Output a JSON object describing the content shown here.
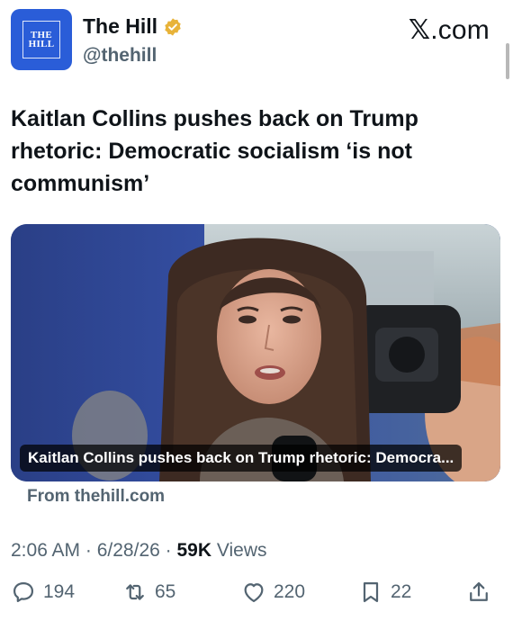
{
  "account": {
    "display_name": "The Hill",
    "handle": "@thehill",
    "avatar_text_line1": "THE",
    "avatar_text_line2": "HILL",
    "verified_badge_color": "#e8b339",
    "avatar_color": "#2a5dd8"
  },
  "brand": {
    "x_letter": "𝕏",
    "suffix": ".com"
  },
  "post": {
    "headline": "Kaitlan Collins pushes back on Trump rhetoric: Democratic socialism ‘is not communism’"
  },
  "link_card": {
    "caption": "Kaitlan Collins pushes back on Trump rhetoric: Democra...",
    "source": "From thehill.com"
  },
  "meta": {
    "time": "2:06 AM",
    "date": "6/28/26",
    "separator": " · ",
    "views_count": "59K",
    "views_label": "Views"
  },
  "actions": {
    "replies": "194",
    "reposts": "65",
    "likes": "220",
    "bookmarks": "22"
  }
}
